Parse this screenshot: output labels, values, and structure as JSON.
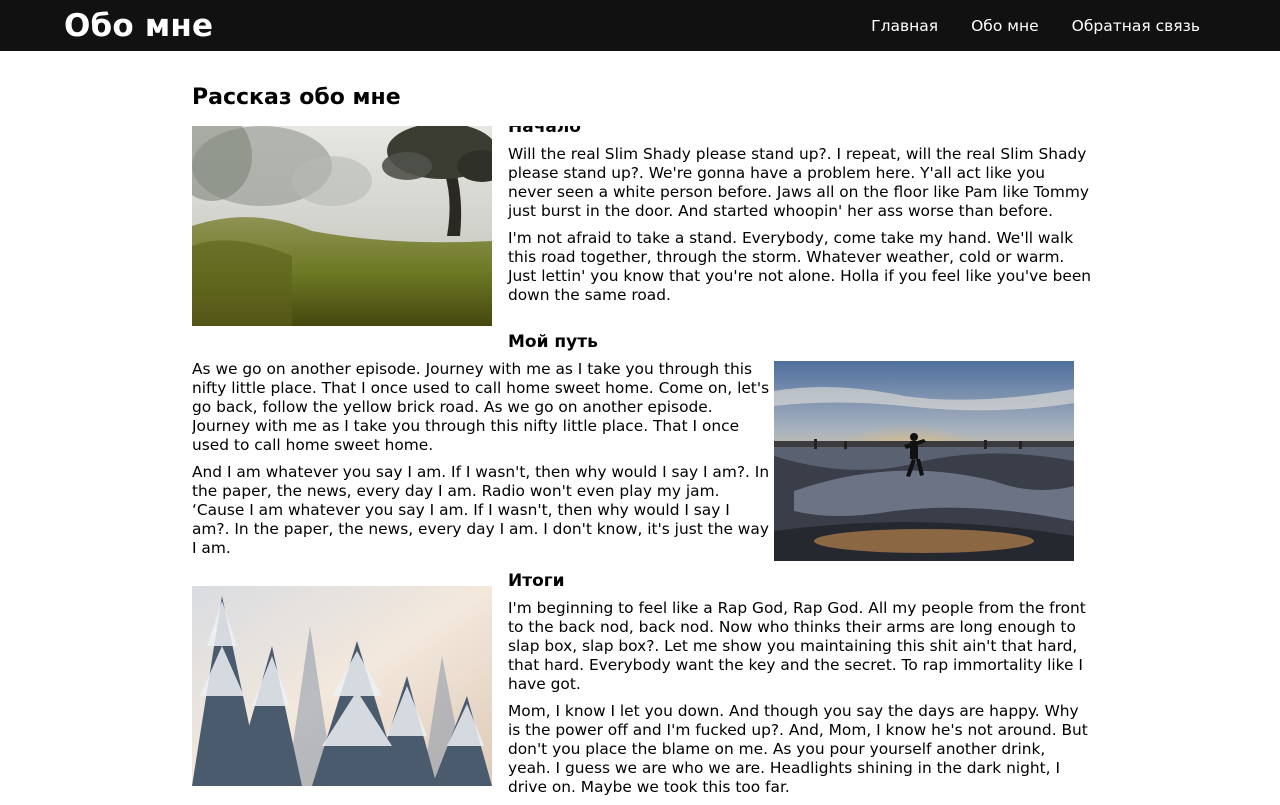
{
  "header": {
    "brand": "Обо мне",
    "nav": [
      "Главная",
      "Обо мне",
      "Обратная связь"
    ]
  },
  "page": {
    "title": "Рассказ обо мне"
  },
  "sections": [
    {
      "heading": "Начало",
      "paragraphs": [
        "Will the real Slim Shady please stand up?. I repeat, will the real Slim Shady please stand up?. We're gonna have a problem here. Y'all act like you never seen a white person before. Jaws all on the floor like Pam like Tommy just burst in the door. And started whoopin' her ass worse than before.",
        "I'm not afraid to take a stand. Everybody, come take my hand. We'll walk this road together, through the storm. Whatever weather, cold or warm. Just lettin' you know that you're not alone. Holla if you feel like you've been down the same road."
      ]
    },
    {
      "heading": "Мой путь",
      "paragraphs": [
        "As we go on another episode. Journey with me as I take you through this nifty little place. That I once used to call home sweet home. Come on, let's go back, follow the yellow brick road. As we go on another episode. Journey with me as I take you through this nifty little place. That I once used to call home sweet home.",
        "And I am whatever you say I am. If I wasn't, then why would I say I am?. In the paper, the news, every day I am. Radio won't even play my jam. ‘Cause I am whatever you say I am. If I wasn't, then why would I say I am?. In the paper, the news, every day I am. I don't know, it's just the way I am."
      ]
    },
    {
      "heading": "Итоги",
      "paragraphs": [
        "I'm beginning to feel like a Rap God, Rap God. All my people from the front to the back nod, back nod. Now who thinks their arms are long enough to slap box, slap box?. Let me show you maintaining this shit ain't that hard, that hard. Everybody want the key and the secret. To rap immortality like I have got.",
        "Mom, I know I let you down. And though you say the days are happy. Why is the power off and I'm fucked up?. And, Mom, I know he's not around. But don't you place the blame on me. As you pour yourself another drink, yeah. I guess we are who we are. Headlights shining in the dark night, I drive on. Maybe we took this too far."
      ]
    }
  ]
}
